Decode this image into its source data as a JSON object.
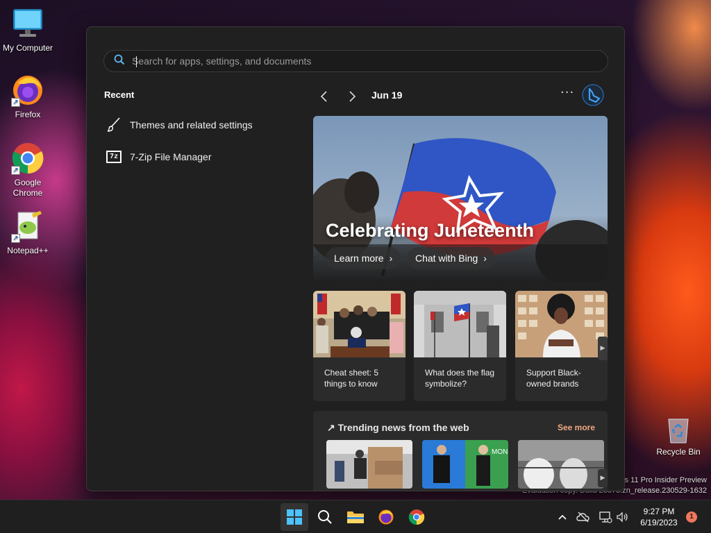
{
  "desktop": {
    "icons": [
      {
        "label": "My Computer",
        "icon": "computer-icon"
      },
      {
        "label": "Firefox",
        "icon": "firefox-icon"
      },
      {
        "label": "Google Chrome",
        "icon": "chrome-icon"
      },
      {
        "label": "Notepad++",
        "icon": "notepadpp-icon"
      }
    ],
    "recycle_bin": "Recycle Bin",
    "watermark_line1": "s 11 Pro Insider Preview",
    "watermark_line2": "Evaluation copy. Build 23575.zn_release.230529-1632"
  },
  "start_menu": {
    "search": {
      "placeholder": "Search for apps, settings, and documents",
      "value": ""
    },
    "recent": {
      "title": "Recent",
      "items": [
        {
          "label": "Themes and related settings",
          "icon": "brush-icon"
        },
        {
          "label": "7-Zip File Manager",
          "icon": "7zip-icon",
          "icon_text": "7z"
        }
      ]
    },
    "date": "Jun 19",
    "more": "···",
    "hero": {
      "title": "Celebrating Juneteenth",
      "buttons": [
        {
          "label": "Learn more"
        },
        {
          "label": "Chat with Bing"
        }
      ]
    },
    "cards": [
      {
        "caption": "Cheat sheet: 5 things to know"
      },
      {
        "caption": "What does the flag symbolize?"
      },
      {
        "caption": "Support Black-owned brands"
      }
    ],
    "trending": {
      "title": "Trending news from the web",
      "see_more": "See more"
    }
  },
  "taskbar": {
    "apps": [
      "start-icon",
      "search-icon",
      "file-explorer-icon",
      "firefox-icon",
      "chrome-icon"
    ],
    "time": "9:27 PM",
    "date": "6/19/2023",
    "notifications": "1"
  },
  "colors": {
    "accent": "#0078d4",
    "see_more": "#f0a880",
    "notification": "#f0765c"
  }
}
